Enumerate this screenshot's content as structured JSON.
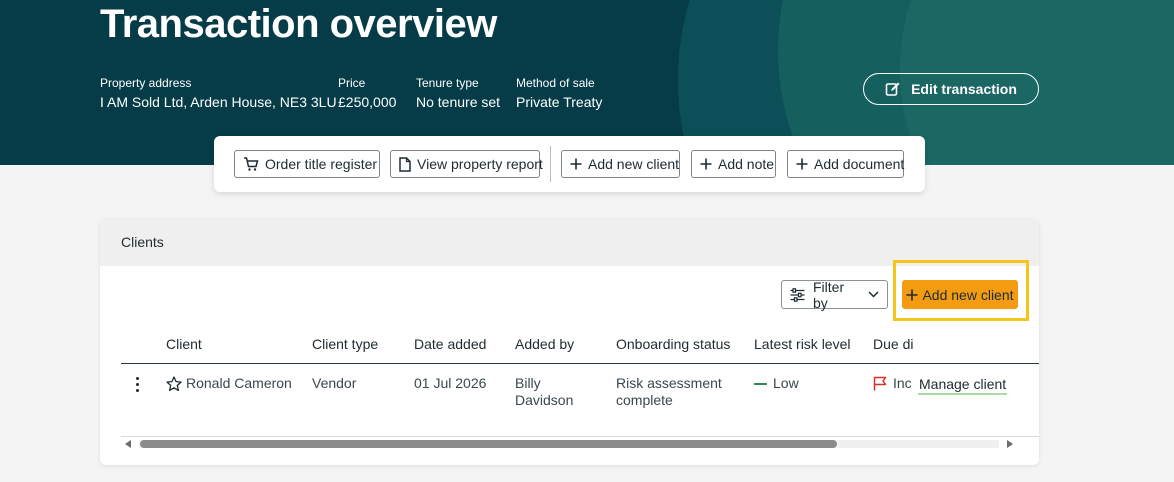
{
  "header": {
    "title": "Transaction overview",
    "property_address_label": "Property address",
    "property_address": "I AM Sold Ltd, Arden House, NE3 3LU",
    "price_label": "Price",
    "price": "£250,000",
    "tenure_label": "Tenure type",
    "tenure": "No tenure set",
    "method_label": "Method of sale",
    "method": "Private Treaty",
    "edit_label": "Edit transaction"
  },
  "toolbar": {
    "order_title": "Order title register",
    "view_report": "View property report",
    "add_client": "Add new client",
    "add_note": "Add note",
    "add_document": "Add document"
  },
  "clients": {
    "title": "Clients",
    "filter_label": "Filter by",
    "add_client_label": "Add new client",
    "columns": [
      "Client",
      "Client type",
      "Date added",
      "Added by",
      "Onboarding status",
      "Latest risk level",
      "Due di"
    ],
    "rows": [
      {
        "client": "Ronald Cameron",
        "client_type": "Vendor",
        "date_added": "01 Jul 2026",
        "added_by_1": "Billy",
        "added_by_2": "Davidson",
        "status_1": "Risk assessment",
        "status_2": "complete",
        "risk": "Low",
        "due": "Inc",
        "action": "Manage client"
      }
    ]
  },
  "colors": {
    "hero": "#053c47",
    "accent": "#f39c12",
    "highlight": "#f5c51b",
    "risk_low": "#2e8b57",
    "flag": "#d9302c"
  }
}
